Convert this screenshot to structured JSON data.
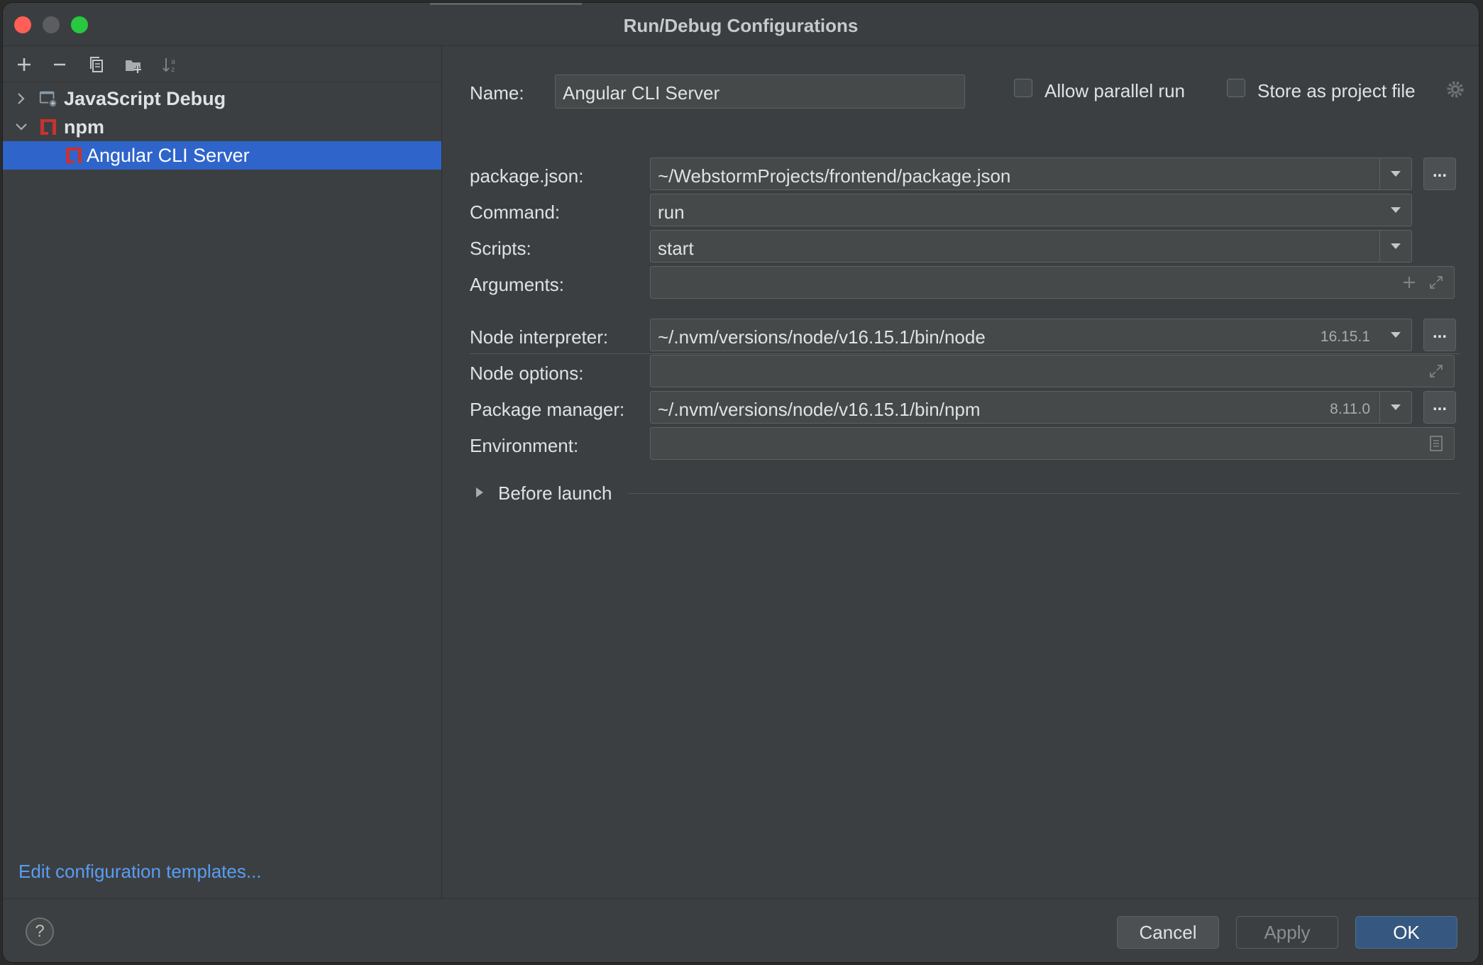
{
  "window": {
    "title": "Run/Debug Configurations"
  },
  "toolbar": {
    "icons": [
      "add-icon",
      "remove-icon",
      "copy-icon",
      "new-folder-icon",
      "sort-icon"
    ]
  },
  "tree": {
    "items": [
      {
        "label": "JavaScript Debug",
        "icon": "javascript-debug-icon",
        "expanded": false
      },
      {
        "label": "npm",
        "icon": "npm-icon",
        "expanded": true
      },
      {
        "label": "Angular CLI Server",
        "icon": "npm-icon",
        "selected": true
      }
    ]
  },
  "edit_templates_link": "Edit configuration templates...",
  "form": {
    "name_label": "Name:",
    "name_value": "Angular CLI Server",
    "allow_parallel_label": "Allow parallel run",
    "store_project_label": "Store as project file",
    "package_json_label": "package.json:",
    "package_json_value": "~/WebstormProjects/frontend/package.json",
    "command_label": "Command:",
    "command_value": "run",
    "scripts_label": "Scripts:",
    "scripts_value": "start",
    "arguments_label": "Arguments:",
    "arguments_value": "",
    "node_interpreter_label": "Node interpreter:",
    "node_interpreter_value": "~/.nvm/versions/node/v16.15.1/bin/node",
    "node_interpreter_version": "16.15.1",
    "node_options_label": "Node options:",
    "node_options_value": "",
    "package_manager_label": "Package manager:",
    "package_manager_value": "~/.nvm/versions/node/v16.15.1/bin/npm",
    "package_manager_version": "8.11.0",
    "environment_label": "Environment:",
    "environment_value": "",
    "before_launch_label": "Before launch",
    "browse_label": "..."
  },
  "buttons": {
    "help": "?",
    "cancel": "Cancel",
    "apply": "Apply",
    "ok": "OK"
  },
  "colors": {
    "selection": "#2f65ca",
    "link": "#589df6",
    "ok_button": "#365880",
    "npm_red": "#c8322f"
  }
}
